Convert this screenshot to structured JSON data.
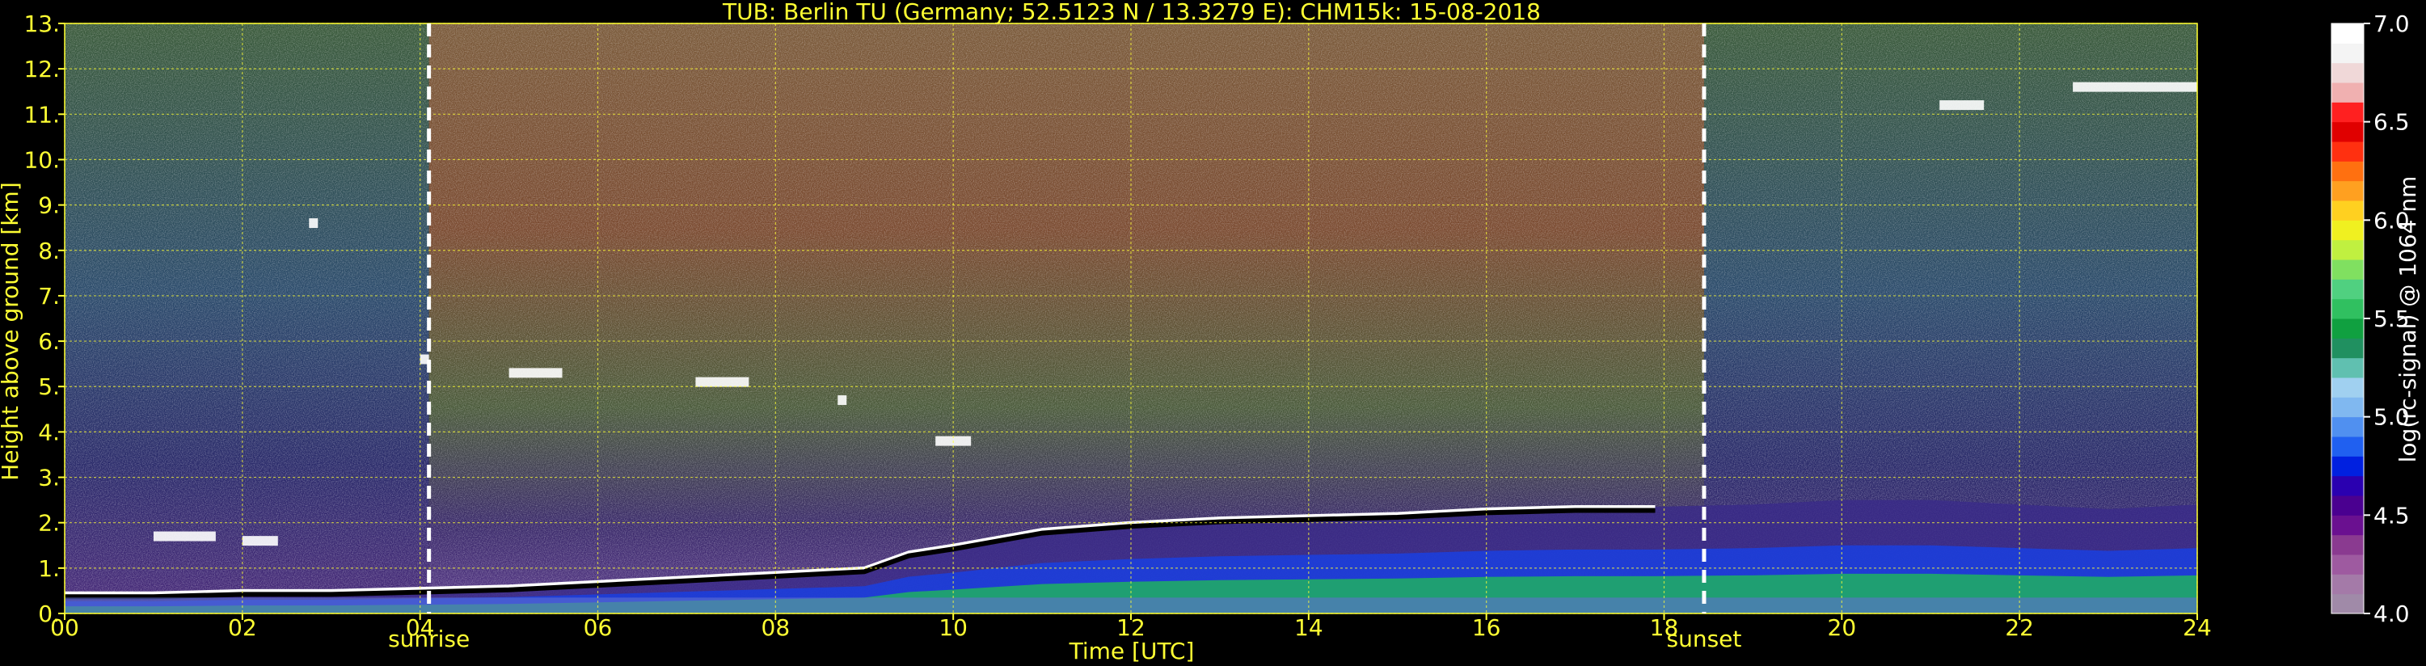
{
  "chart_data": {
    "type": "heatmap",
    "title": "TUB: Berlin TU (Germany; 52.5123 N / 13.3279 E):    CHM15k: 15-08-2018",
    "xlabel": "Time [UTC]",
    "ylabel": "Height above ground [km]",
    "xlim": [
      0,
      24
    ],
    "ylim": [
      0,
      13
    ],
    "x_ticks": [
      "00",
      "02",
      "04",
      "06",
      "08",
      "10",
      "12",
      "14",
      "16",
      "18",
      "20",
      "22",
      "24"
    ],
    "y_ticks": [
      "0.",
      "1.",
      "2.",
      "3.",
      "4.",
      "5.",
      "6.",
      "7.",
      "8.",
      "9.",
      "10.",
      "11.",
      "12.",
      "13."
    ],
    "grid": true,
    "markers": [
      {
        "label": "sunrise",
        "time": 4.1
      },
      {
        "label": "sunset",
        "time": 18.45
      }
    ],
    "boundary_layer_top_km": [
      {
        "t": 0.0,
        "h": 0.45
      },
      {
        "t": 1.0,
        "h": 0.45
      },
      {
        "t": 2.0,
        "h": 0.5
      },
      {
        "t": 3.0,
        "h": 0.5
      },
      {
        "t": 4.0,
        "h": 0.55
      },
      {
        "t": 5.0,
        "h": 0.6
      },
      {
        "t": 6.0,
        "h": 0.7
      },
      {
        "t": 7.0,
        "h": 0.8
      },
      {
        "t": 8.0,
        "h": 0.9
      },
      {
        "t": 9.0,
        "h": 1.0
      },
      {
        "t": 9.5,
        "h": 1.35
      },
      {
        "t": 10.0,
        "h": 1.5
      },
      {
        "t": 11.0,
        "h": 1.85
      },
      {
        "t": 12.0,
        "h": 2.0
      },
      {
        "t": 13.0,
        "h": 2.1
      },
      {
        "t": 14.0,
        "h": 2.15
      },
      {
        "t": 15.0,
        "h": 2.2
      },
      {
        "t": 16.0,
        "h": 2.3
      },
      {
        "t": 17.0,
        "h": 2.35
      },
      {
        "t": 17.9,
        "h": 2.35
      }
    ],
    "residual_layer_km": [
      {
        "t": 17.9,
        "h": 2.35
      },
      {
        "t": 19.0,
        "h": 2.4
      },
      {
        "t": 20.0,
        "h": 2.5
      },
      {
        "t": 21.0,
        "h": 2.5
      },
      {
        "t": 22.0,
        "h": 2.4
      },
      {
        "t": 23.0,
        "h": 2.3
      },
      {
        "t": 24.0,
        "h": 2.4
      }
    ],
    "clouds": [
      {
        "t_start": 1.0,
        "t_end": 1.7,
        "h": 1.7
      },
      {
        "t_start": 2.0,
        "t_end": 2.4,
        "h": 1.6
      },
      {
        "t_start": 2.75,
        "t_end": 2.85,
        "h": 8.6
      },
      {
        "t_start": 4.0,
        "t_end": 4.1,
        "h": 5.6
      },
      {
        "t_start": 5.0,
        "t_end": 5.6,
        "h": 5.3
      },
      {
        "t_start": 7.1,
        "t_end": 7.7,
        "h": 5.1
      },
      {
        "t_start": 8.7,
        "t_end": 8.8,
        "h": 4.7
      },
      {
        "t_start": 9.8,
        "t_end": 10.2,
        "h": 3.8
      },
      {
        "t_start": 21.1,
        "t_end": 21.6,
        "h": 11.2
      },
      {
        "t_start": 22.6,
        "t_end": 24.0,
        "h": 11.6
      }
    ],
    "colorbar": {
      "label": "log(rc-signal) @ 1064 nm",
      "range": [
        4.0,
        7.0
      ],
      "ticks": [
        "4.0",
        "4.5",
        "5.0",
        "5.5",
        "6.0",
        "6.5",
        "7.0"
      ],
      "colors": [
        "#a08aa8",
        "#a47aa8",
        "#9e5aa0",
        "#8a3a90",
        "#6a1090",
        "#4a0090",
        "#2a00b0",
        "#0020e0",
        "#2060f0",
        "#5090f0",
        "#80b8f0",
        "#a0d0f0",
        "#60c0b0",
        "#209060",
        "#10a040",
        "#30c060",
        "#50d080",
        "#80e060",
        "#c0f040",
        "#f0f020",
        "#ffd020",
        "#ffa020",
        "#ff7010",
        "#ff3010",
        "#e00000",
        "#ff2020",
        "#f0b0b0",
        "#f0d8d8",
        "#f4f4f4",
        "#ffffff"
      ]
    }
  }
}
